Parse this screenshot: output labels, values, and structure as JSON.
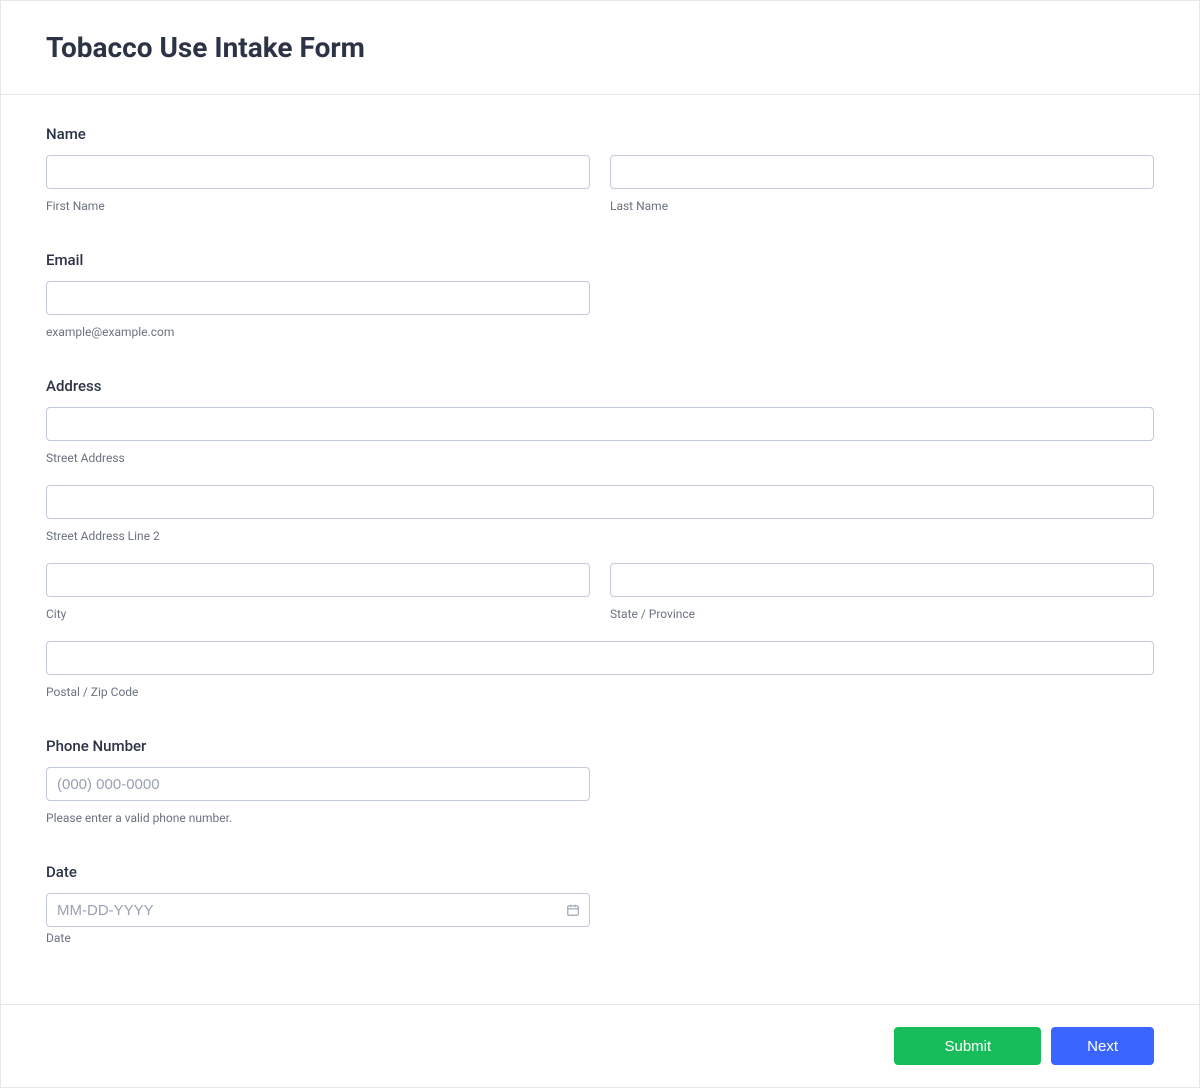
{
  "header": {
    "title": "Tobacco Use Intake Form"
  },
  "fields": {
    "name": {
      "label": "Name",
      "first_sublabel": "First Name",
      "last_sublabel": "Last Name",
      "first_value": "",
      "last_value": ""
    },
    "email": {
      "label": "Email",
      "sublabel": "example@example.com",
      "value": ""
    },
    "address": {
      "label": "Address",
      "street_sublabel": "Street Address",
      "street_value": "",
      "street2_sublabel": "Street Address Line 2",
      "street2_value": "",
      "city_sublabel": "City",
      "city_value": "",
      "state_sublabel": "State / Province",
      "state_value": "",
      "postal_sublabel": "Postal / Zip Code",
      "postal_value": ""
    },
    "phone": {
      "label": "Phone Number",
      "placeholder": "(000) 000-0000",
      "sublabel": "Please enter a valid phone number.",
      "value": ""
    },
    "date": {
      "label": "Date",
      "placeholder": "MM-DD-YYYY",
      "sublabel": "Date",
      "value": ""
    }
  },
  "buttons": {
    "submit": "Submit",
    "next": "Next"
  }
}
